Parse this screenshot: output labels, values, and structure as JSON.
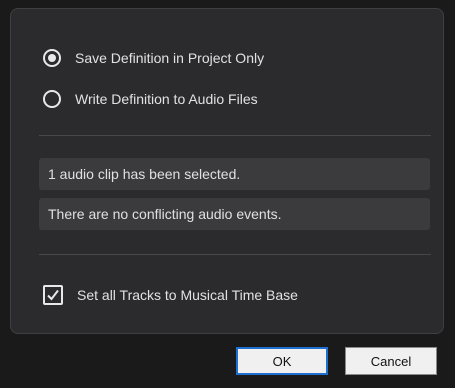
{
  "options": {
    "save_in_project": "Save Definition in Project Only",
    "write_to_files": "Write Definition to Audio Files",
    "selected_option": "save_in_project"
  },
  "info": {
    "clip_count_text": "1 audio clip has been selected.",
    "conflict_text": "There are no conflicting audio events."
  },
  "musical_time_base": {
    "label": "Set all Tracks to Musical Time Base",
    "checked": true
  },
  "buttons": {
    "ok": "OK",
    "cancel": "Cancel"
  }
}
